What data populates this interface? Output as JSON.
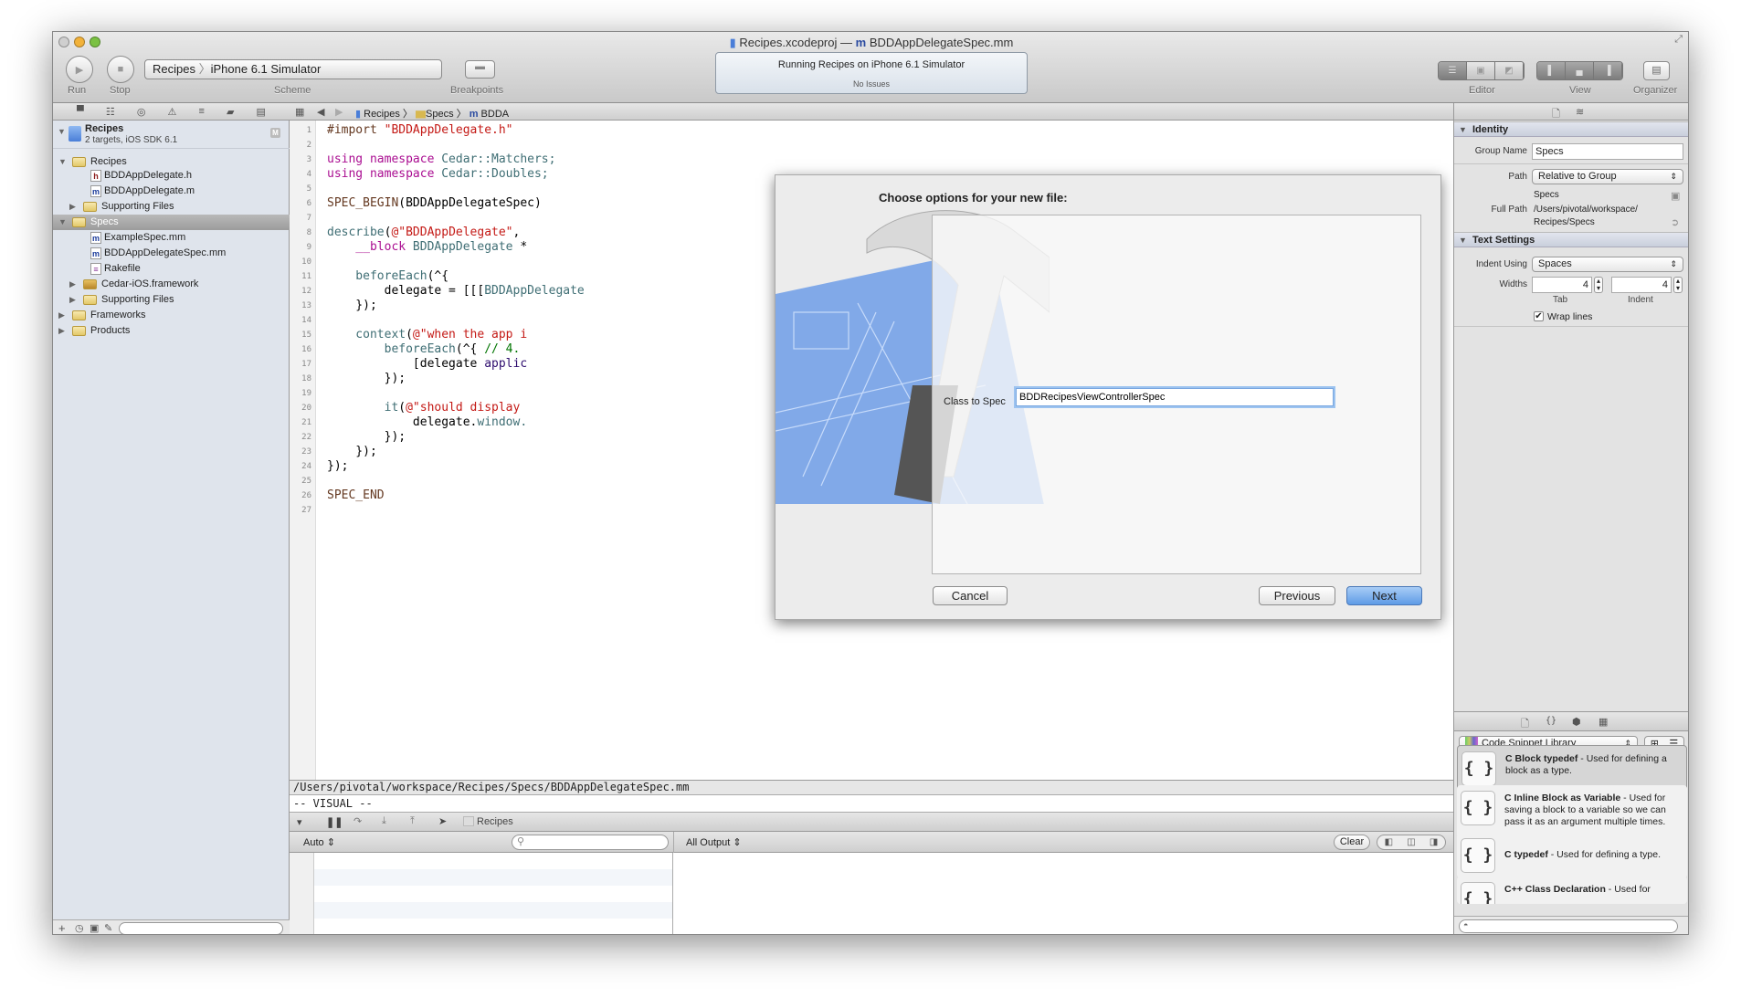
{
  "window": {
    "title_project": "Recipes.xcodeproj",
    "title_sep": "—",
    "title_file": "BDDAppDelegateSpec.mm"
  },
  "toolbar": {
    "run_label": "Run",
    "stop_label": "Stop",
    "scheme_label": "Scheme",
    "scheme_target": "Recipes",
    "scheme_device": "iPhone 6.1 Simulator",
    "breakpoints_label": "Breakpoints",
    "activity_status": "Running Recipes on iPhone 6.1 Simulator",
    "activity_issues": "No Issues",
    "editor_label": "Editor",
    "view_label": "View",
    "organizer_label": "Organizer"
  },
  "navigator": {
    "project": {
      "name": "Recipes",
      "subtitle": "2 targets, iOS SDK 6.1",
      "badge": "M"
    },
    "items": [
      {
        "label": "Recipes",
        "type": "folder",
        "level": 1,
        "disclosure": "open"
      },
      {
        "label": "BDDAppDelegate.h",
        "type": "h",
        "level": 2
      },
      {
        "label": "BDDAppDelegate.m",
        "type": "m",
        "level": 2
      },
      {
        "label": "Supporting Files",
        "type": "folder",
        "level": 2,
        "disclosure": "closed"
      },
      {
        "label": "Specs",
        "type": "folder",
        "level": 1,
        "disclosure": "open",
        "selected": true
      },
      {
        "label": "ExampleSpec.mm",
        "type": "m",
        "level": 2
      },
      {
        "label": "BDDAppDelegateSpec.mm",
        "type": "m",
        "level": 2
      },
      {
        "label": "Rakefile",
        "type": "script",
        "level": 2
      },
      {
        "label": "Cedar-iOS.framework",
        "type": "framework",
        "level": 2,
        "disclosure": "closed"
      },
      {
        "label": "Supporting Files",
        "type": "folder",
        "level": 2,
        "disclosure": "closed"
      },
      {
        "label": "Frameworks",
        "type": "folder",
        "level": 1,
        "disclosure": "closed"
      },
      {
        "label": "Products",
        "type": "folder",
        "level": 1,
        "disclosure": "closed"
      }
    ]
  },
  "jumpbar": {
    "crumbs": [
      "Recipes",
      "Specs",
      "BDDA"
    ]
  },
  "code": {
    "lines": [
      [
        [
          "#import ",
          "pp"
        ],
        [
          "\"BDDAppDelegate.h\"",
          "str"
        ]
      ],
      [],
      [
        [
          "using namespace ",
          "kw"
        ],
        [
          "Cedar::Matchers;",
          "ty"
        ]
      ],
      [
        [
          "using namespace ",
          "kw"
        ],
        [
          "Cedar::Doubles;",
          "ty"
        ]
      ],
      [],
      [
        [
          "SPEC_BEGIN",
          "pp"
        ],
        [
          "(BDDAppDelegateSpec)",
          "pl"
        ]
      ],
      [],
      [
        [
          "describe",
          "ty"
        ],
        [
          "(",
          "pl"
        ],
        [
          "@\"BDDAppDelegate\"",
          "str"
        ],
        [
          ",",
          "pl"
        ]
      ],
      [
        [
          "    __block ",
          "kw"
        ],
        [
          "BDDAppDelegate ",
          "ty"
        ],
        [
          "*",
          "pl"
        ]
      ],
      [],
      [
        [
          "    beforeEach",
          "ty"
        ],
        [
          "(^{",
          "pl"
        ]
      ],
      [
        [
          "        delegate = [[[",
          "pl"
        ],
        [
          "BDDAppDelegate",
          "ty"
        ]
      ],
      [
        [
          "    });",
          "pl"
        ]
      ],
      [],
      [
        [
          "    context",
          "ty"
        ],
        [
          "(",
          "pl"
        ],
        [
          "@\"when the app i",
          "str"
        ]
      ],
      [
        [
          "        beforeEach",
          "ty"
        ],
        [
          "(^{ ",
          "pl"
        ],
        [
          "// 4.",
          "cm"
        ]
      ],
      [
        [
          "            [delegate ",
          "pl"
        ],
        [
          "applic",
          "me"
        ]
      ],
      [
        [
          "        });",
          "pl"
        ]
      ],
      [],
      [
        [
          "        it",
          "ty"
        ],
        [
          "(",
          "pl"
        ],
        [
          "@\"should display",
          "str"
        ]
      ],
      [
        [
          "            delegate.",
          "pl"
        ],
        [
          "window.",
          "ty"
        ]
      ],
      [
        [
          "        });",
          "pl"
        ]
      ],
      [
        [
          "    });",
          "pl"
        ]
      ],
      [
        [
          "});",
          "pl"
        ]
      ],
      [],
      [
        [
          "SPEC_END",
          "pp"
        ]
      ],
      []
    ]
  },
  "dialog": {
    "title": "Choose options for your new file:",
    "field_label": "Class to Spec",
    "field_value": "BDDRecipesViewControllerSpec",
    "cancel": "Cancel",
    "previous": "Previous",
    "next": "Next"
  },
  "vim": {
    "path": "/Users/pivotal/workspace/Recipes/Specs/BDDAppDelegateSpec.mm",
    "mode": "-- VISUAL --"
  },
  "debug": {
    "process": "Recipes",
    "variables_scope": "Auto",
    "search_placeholder": "",
    "output_scope": "All Output",
    "clear": "Clear"
  },
  "inspector": {
    "identity": {
      "header": "Identity",
      "group_name_label": "Group Name",
      "group_name": "Specs",
      "path_label": "Path",
      "path_value": "Relative to Group",
      "path_name": "Specs",
      "full_path_label": "Full Path",
      "full_path_1": "/Users/pivotal/workspace/",
      "full_path_2": "Recipes/Specs"
    },
    "text_settings": {
      "header": "Text Settings",
      "indent_using_label": "Indent Using",
      "indent_using": "Spaces",
      "widths_label": "Widths",
      "tab_width": "4",
      "indent_width": "4",
      "tab_label": "Tab",
      "indent_label": "Indent",
      "wrap_lines_label": "Wrap lines",
      "wrap_lines": true
    }
  },
  "library": {
    "selector": "Code Snippet Library",
    "snippets": [
      {
        "title": "C Block typedef",
        "desc": " - Used for defining a block as a type.",
        "selected": true
      },
      {
        "title": "C Inline Block as Variable",
        "desc": " - Used for saving a block to a variable so we can pass it as an argument multiple times."
      },
      {
        "title": "C typedef",
        "desc": " - Used for defining a type."
      },
      {
        "title": "C++ Class Declaration",
        "desc": " - Used for"
      }
    ]
  },
  "colors": {
    "selection": "#a7a7a7",
    "next_button": "#6ea6ea",
    "blueprint": "#5b8fe6"
  }
}
